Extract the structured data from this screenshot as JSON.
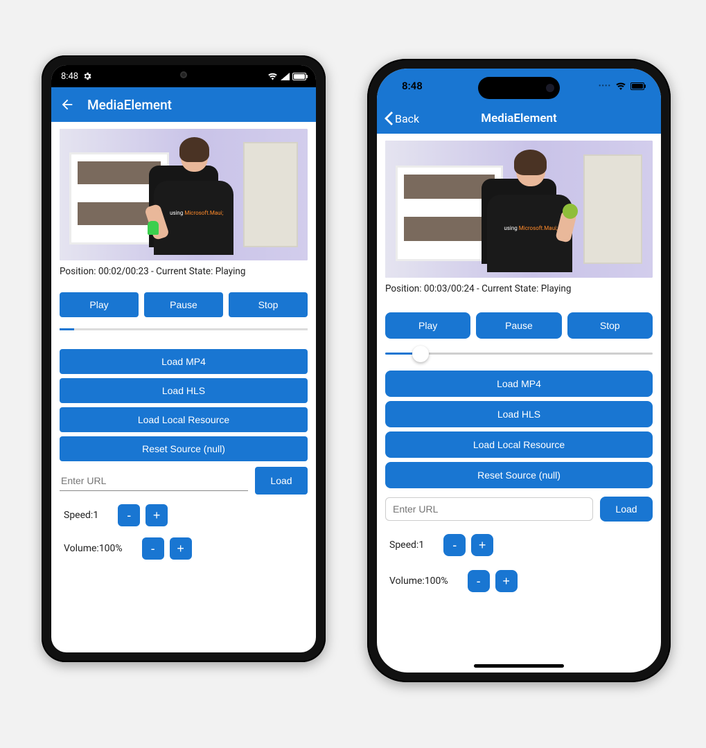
{
  "colors": {
    "primary": "#1976d2"
  },
  "android": {
    "status": {
      "time": "8:48"
    },
    "header": {
      "title": "MediaElement"
    },
    "position_line": "Position: 00:02/00:23 - Current State: Playing",
    "buttons": {
      "play": "Play",
      "pause": "Pause",
      "stop": "Stop"
    },
    "load": {
      "mp4": "Load MP4",
      "hls": "Load HLS",
      "local": "Load Local Resource",
      "reset": "Reset Source (null)"
    },
    "url": {
      "placeholder": "Enter URL",
      "load": "Load"
    },
    "speed": {
      "label": "Speed:",
      "value": "1",
      "minus": "-",
      "plus": "+"
    },
    "volume": {
      "label": "Volume:",
      "value": "100%",
      "minus": "-",
      "plus": "+"
    },
    "shirt": {
      "prefix": "using ",
      "brand": "Microsoft.Maui;"
    }
  },
  "ios": {
    "status": {
      "time": "8:48"
    },
    "header": {
      "back": "Back",
      "title": "MediaElement"
    },
    "position_line": "Position: 00:03/00:24 - Current State: Playing",
    "buttons": {
      "play": "Play",
      "pause": "Pause",
      "stop": "Stop"
    },
    "load": {
      "mp4": "Load MP4",
      "hls": "Load HLS",
      "local": "Load Local Resource",
      "reset": "Reset Source (null)"
    },
    "url": {
      "placeholder": "Enter URL",
      "load": "Load"
    },
    "speed": {
      "label": "Speed:",
      "value": "1",
      "minus": "-",
      "plus": "+"
    },
    "volume": {
      "label": "Volume:",
      "value": "100%",
      "minus": "-",
      "plus": "+"
    },
    "shirt": {
      "prefix": "using ",
      "brand": "Microsoft.Maui;"
    }
  }
}
